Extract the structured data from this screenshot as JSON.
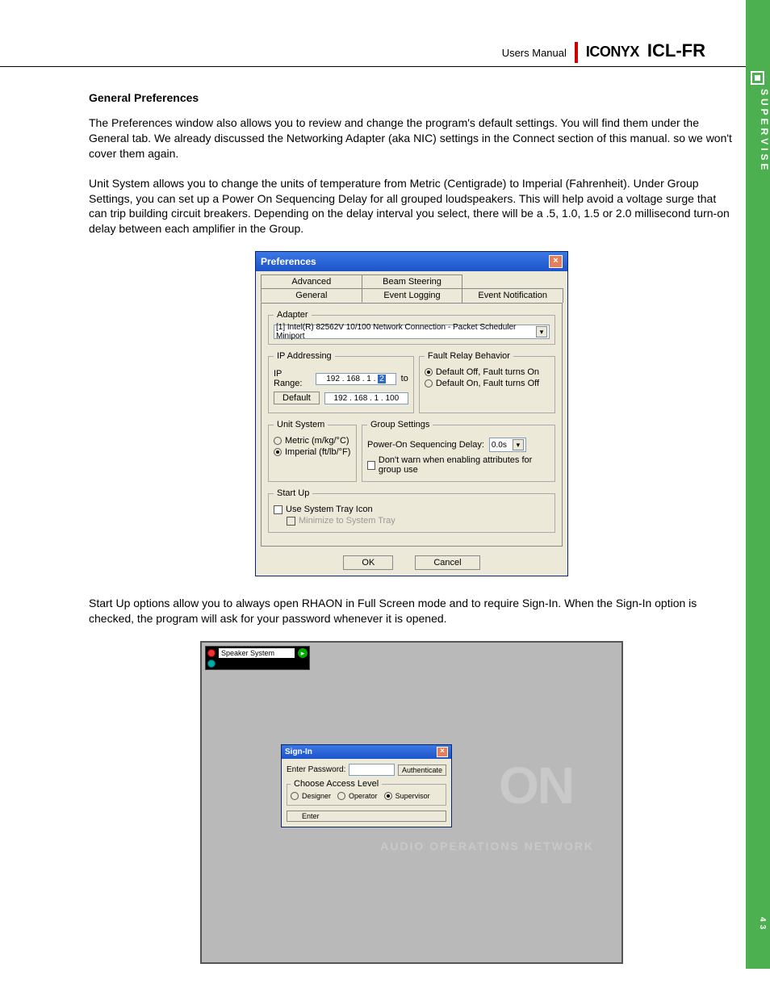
{
  "header": {
    "users_manual": "Users Manual",
    "brand": "ICONYX",
    "model": "ICL-FR"
  },
  "side": {
    "label": "SUPERVISE",
    "page": "43"
  },
  "text": {
    "h1": "General Preferences",
    "p1": "The Preferences window  also allows you to review and change the program's default settings. You will find them under the General tab. We already discussed the Networking Adapter (aka NIC) settings in the Connect section of this manual. so we won't cover them again.",
    "p2": "Unit System allows you to change the units of temperature from Metric (Centigrade) to Imperial (Fahrenheit). Under Group Settings, you can set up a Power On Sequencing Delay for all grouped loudspeakers. This will help avoid a voltage surge that can trip building circuit breakers. Depending on the delay interval you select, there will be a .5, 1.0, 1.5 or 2.0 millisecond turn-on delay between each amplifier in the Group.",
    "p3": "Start Up options allow you to always open RHAON in Full Screen mode and to require Sign-In.  When the Sign-In option is checked, the program will ask for your password whenever it is opened."
  },
  "prefs": {
    "title": "Preferences",
    "tabs_back": [
      "Advanced",
      "Beam Steering"
    ],
    "tabs_front": [
      "General",
      "Event Logging",
      "Event Notification"
    ],
    "adapter": {
      "legend": "Adapter",
      "value": "[1] Intel(R) 82562V 10/100 Network Connection - Packet Scheduler Miniport"
    },
    "ip": {
      "legend": "IP Addressing",
      "range_label": "IP Range:",
      "range_value": "192 . 168 .  1  . ",
      "range_hl": "2",
      "to": "to",
      "default_btn": "Default",
      "default_value": "192 . 168 .  1  . 100"
    },
    "fault": {
      "legend": "Fault Relay Behavior",
      "opt1": "Default Off, Fault turns On",
      "opt2": "Default On, Fault turns Off"
    },
    "unit": {
      "legend": "Unit System",
      "opt1": "Metric (m/kg/°C)",
      "opt2": "Imperial (ft/lb/°F)"
    },
    "group": {
      "legend": "Group Settings",
      "delay_label": "Power-On Sequencing Delay:",
      "delay_value": "0.0s",
      "dontwarn": "Don't warn when enabling attributes for group use"
    },
    "startup": {
      "legend": "Start Up",
      "tray": "Use System Tray Icon",
      "min": "Minimize to System Tray"
    },
    "ok": "OK",
    "cancel": "Cancel"
  },
  "app": {
    "tree_label": "Speaker System",
    "watermark_sub": "AUDIO OPERATIONS NETWORK",
    "signin": {
      "title": "Sign-In",
      "pwd_label": "Enter Password:",
      "auth": "Authenticate",
      "access_legend": "Choose Access Level",
      "designer": "Designer",
      "operator": "Operator",
      "supervisor": "Supervisor",
      "enter": "Enter"
    }
  }
}
